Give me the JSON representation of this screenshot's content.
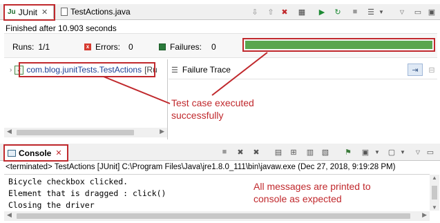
{
  "junit_view": {
    "tabs": [
      {
        "label": "JUnit",
        "icon": "junit-icon",
        "active": true
      },
      {
        "label": "TestActions.java",
        "icon": "java-file-icon",
        "active": false
      }
    ],
    "status": "Finished after 10.903 seconds",
    "runs_label": "Runs:",
    "runs_value": "1/1",
    "errors_label": "Errors:",
    "errors_value": "0",
    "failures_label": "Failures:",
    "failures_value": "0",
    "progress_fraction": 1.0,
    "progress_color": "#5aa64f",
    "test_item": "com.blog.junitTests.TestActions",
    "test_item_suffix": "[Ru",
    "failure_trace_label": "Failure Trace"
  },
  "console_view": {
    "tab_label": "Console",
    "process_line": "<terminated> TestActions [JUnit] C:\\Program Files\\Java\\jre1.8.0_111\\bin\\javaw.exe (Dec 27, 2018, 9:19:28 PM)",
    "lines": [
      "Bicycle checkbox clicked.",
      "Element that is dragged : click()",
      "Closing the driver"
    ]
  },
  "annotations": {
    "test_case": [
      "Test case executed",
      "successfully"
    ],
    "console": [
      "All messages are printed to",
      "console as expected"
    ],
    "color": "#c0282c"
  }
}
